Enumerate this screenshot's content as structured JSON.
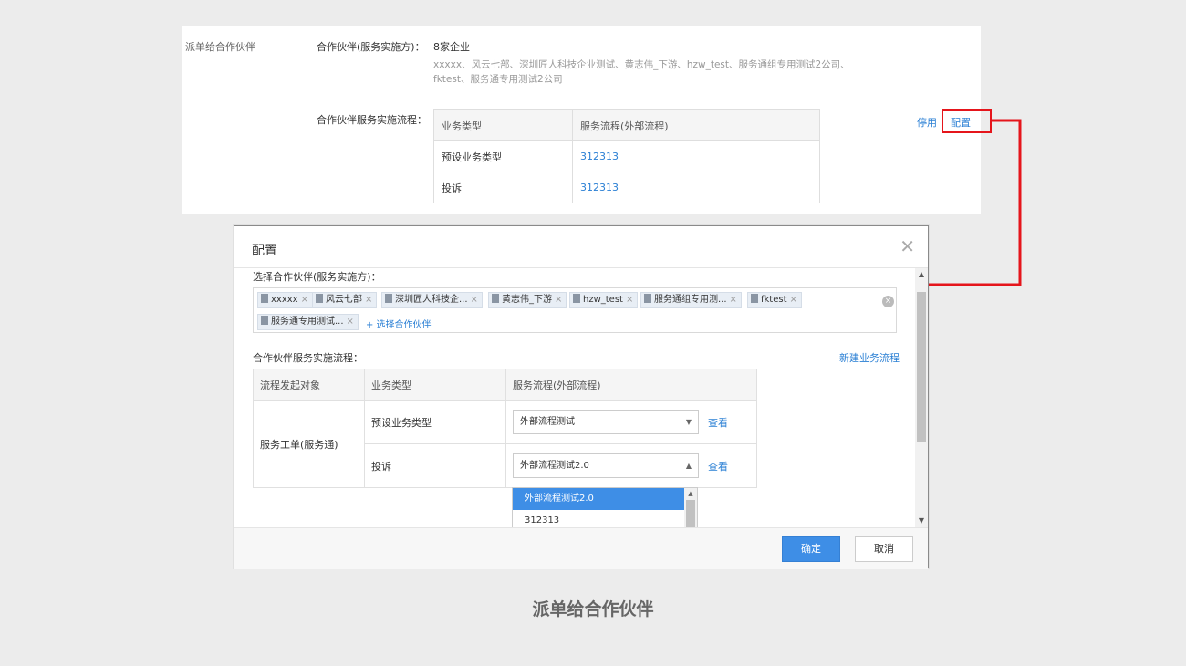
{
  "top": {
    "section_label": "派单给合作伙伴",
    "partner_label": "合作伙伴(服务实施方)：",
    "partner_count": "8家企业",
    "partner_list_line1": "xxxxx、风云七部、深圳匠人科技企业测试、黄志伟_下游、hzw_test、服务通组专用测试2公司、",
    "partner_list_line2": "fktest、服务通专用测试2公司",
    "flow_label": "合作伙伴服务实施流程：",
    "table_headers": [
      "业务类型",
      "服务流程(外部流程)"
    ],
    "rows": [
      {
        "type": "预设业务类型",
        "flow": "312313"
      },
      {
        "type": "投诉",
        "flow": "312313"
      }
    ],
    "disable_link": "停用",
    "config_link": "配置"
  },
  "dialog": {
    "title": "配置",
    "select_partner_label": "选择合作伙伴(服务实施方)：",
    "tags": [
      "xxxxx",
      "风云七部",
      "深圳匠人科技企...",
      "黄志伟_下游",
      "hzw_test",
      "服务通组专用测...",
      "fktest",
      "服务通专用测试..."
    ],
    "add_partner": "+ 选择合作伙伴",
    "flow_label": "合作伙伴服务实施流程：",
    "new_flow_link": "新建业务流程",
    "table_headers": [
      "流程发起对象",
      "业务类型",
      "服务流程(外部流程)"
    ],
    "initiator": "服务工单(服务通)",
    "rows": [
      {
        "type": "预设业务类型",
        "selected": "外部流程测试",
        "view": "查看"
      },
      {
        "type": "投诉",
        "selected": "外部流程测试2.0",
        "view": "查看"
      }
    ],
    "dropdown_options": [
      "外部流程测试2.0",
      "312313"
    ],
    "ok_button": "确定",
    "cancel_button": "取消"
  },
  "caption": "派单给合作伙伴",
  "colors": {
    "accent": "#3e8ee6",
    "highlight": "#e5151b",
    "link": "#2a7fd4"
  }
}
